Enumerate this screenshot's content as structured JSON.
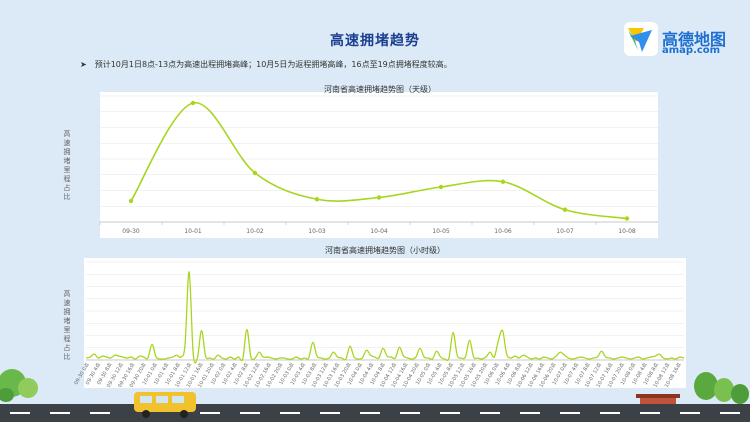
{
  "header": {
    "title": "高速拥堵趋势",
    "logo_name": "高德地图",
    "logo_url_text": "amap.com",
    "bullet": "预计10月1日8点-13点为高速出程拥堵高峰；10月5日为返程拥堵高峰，16点至19点拥堵程度较高。"
  },
  "colors": {
    "line": "#a8d61e",
    "title": "#1c3f8f",
    "grid": "#e6e6e6",
    "background": "#dbeaf6"
  },
  "chart_data": [
    {
      "type": "line",
      "title": "河南省高速拥堵趋势图（天级）",
      "ylabel": "高速拥堵里程占比",
      "categories": [
        "09-30",
        "10-01",
        "10-02",
        "10-03",
        "10-04",
        "10-05",
        "10-06",
        "10-07",
        "10-08"
      ],
      "values": [
        12,
        68,
        28,
        13,
        14,
        20,
        23,
        7,
        2
      ],
      "ylim": [
        0,
        72
      ],
      "grid": true,
      "smooth": true
    },
    {
      "type": "line",
      "title": "河南省高速拥堵趋势图（小时级）",
      "ylabel": "高速拥堵里程占比",
      "tick_labels": [
        "09-30 0点",
        "09-30 4点",
        "09-30 8点",
        "09-30 12点",
        "09-30 16点",
        "09-30 20点",
        "10-01 0点",
        "10-01 4点",
        "10-01 8点",
        "10-01 12点",
        "10-01 16点",
        "10-01 20点",
        "10-02 0点",
        "10-02 4点",
        "10-02 8点",
        "10-02 12点",
        "10-02 16点",
        "10-02 20点",
        "10-03 0点",
        "10-03 4点",
        "10-03 8点",
        "10-03 12点",
        "10-03 16点",
        "10-03 20点",
        "10-04 0点",
        "10-04 4点",
        "10-04 8点",
        "10-04 12点",
        "10-04 16点",
        "10-04 20点",
        "10-05 0点",
        "10-05 4点",
        "10-05 8点",
        "10-05 12点",
        "10-05 16点",
        "10-05 20点",
        "10-06 0点",
        "10-06 4点",
        "10-06 8点",
        "10-06 12点",
        "10-06 16点",
        "10-06 20点",
        "10-07 0点",
        "10-07 4点",
        "10-07 8点",
        "10-07 12点",
        "10-07 16点",
        "10-07 20点",
        "10-08 0点",
        "10-08 4点",
        "10-08 8点",
        "10-08 12点",
        "10-08 16点"
      ],
      "x_hours": [
        0,
        4,
        8,
        12,
        16,
        20,
        24,
        28,
        32,
        36,
        40,
        44,
        48,
        52,
        56,
        60,
        64,
        68,
        72,
        76,
        80,
        84,
        88,
        92,
        96,
        100,
        104,
        108,
        112,
        116,
        120,
        124,
        128,
        132,
        136,
        140,
        144,
        148,
        152,
        156,
        160,
        164,
        168,
        172,
        176,
        180,
        184,
        188,
        192,
        196,
        200,
        204,
        208
      ],
      "values": [
        2,
        3,
        6,
        2,
        4,
        3,
        2,
        5,
        4,
        3,
        2,
        3,
        1,
        4,
        3,
        2,
        16,
        3,
        1,
        1,
        2,
        3,
        5,
        3,
        15,
        90,
        6,
        2,
        30,
        4,
        2,
        1,
        5,
        2,
        1,
        3,
        1,
        3,
        1,
        31,
        3,
        2,
        8,
        3,
        3,
        2,
        1,
        2,
        2,
        1,
        1,
        3,
        1,
        2,
        2,
        18,
        4,
        2,
        1,
        2,
        8,
        3,
        2,
        1,
        14,
        3,
        1,
        2,
        10,
        5,
        3,
        2,
        12,
        4,
        3,
        2,
        13,
        4,
        2,
        1,
        3,
        12,
        3,
        2,
        1,
        9,
        3,
        1,
        2,
        28,
        5,
        2,
        3,
        20,
        3,
        2,
        1,
        3,
        8,
        3,
        20,
        30,
        6,
        2,
        4,
        2,
        5,
        3,
        1,
        2,
        1,
        3,
        2,
        1,
        4,
        8,
        5,
        2,
        1,
        2,
        3,
        2,
        1,
        2,
        3,
        9,
        3,
        2,
        1,
        2,
        3,
        2,
        1,
        2,
        3,
        1,
        2,
        3,
        4,
        6,
        2,
        1,
        2,
        1,
        3,
        2
      ],
      "ylim": [
        0,
        100
      ],
      "grid": true
    }
  ]
}
